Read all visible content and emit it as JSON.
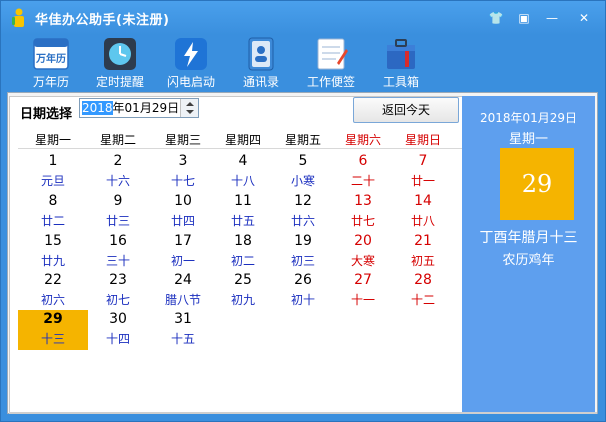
{
  "window": {
    "title": "华佳办公助手(未注册)",
    "controls": {
      "skin": "👕",
      "restore": "▣",
      "minimize": "—",
      "close": "✕"
    }
  },
  "toolbar": {
    "items": [
      {
        "label": "万年历",
        "icon": "calendar-icon",
        "icon_text": "万年历"
      },
      {
        "label": "定时提醒",
        "icon": "clock-icon"
      },
      {
        "label": "闪电启动",
        "icon": "lightning-icon"
      },
      {
        "label": "通讯录",
        "icon": "contacts-icon"
      },
      {
        "label": "工作便签",
        "icon": "notepad-icon"
      },
      {
        "label": "工具箱",
        "icon": "toolbox-icon"
      }
    ]
  },
  "calendar": {
    "date_label": "日期选择",
    "date_value_year": "2018",
    "date_value_rest": "年01月29日",
    "today_button": "返回今天",
    "weekdays": [
      "星期一",
      "星期二",
      "星期三",
      "星期四",
      "星期五",
      "星期六",
      "星期日"
    ],
    "days": [
      {
        "n": "1",
        "l": "元旦"
      },
      {
        "n": "2",
        "l": "十六"
      },
      {
        "n": "3",
        "l": "十七"
      },
      {
        "n": "4",
        "l": "十八"
      },
      {
        "n": "5",
        "l": "小寒"
      },
      {
        "n": "6",
        "l": "二十"
      },
      {
        "n": "7",
        "l": "廿一"
      },
      {
        "n": "8",
        "l": "廿二"
      },
      {
        "n": "9",
        "l": "廿三"
      },
      {
        "n": "10",
        "l": "廿四"
      },
      {
        "n": "11",
        "l": "廿五"
      },
      {
        "n": "12",
        "l": "廿六"
      },
      {
        "n": "13",
        "l": "廿七"
      },
      {
        "n": "14",
        "l": "廿八"
      },
      {
        "n": "15",
        "l": "廿九"
      },
      {
        "n": "16",
        "l": "三十"
      },
      {
        "n": "17",
        "l": "初一"
      },
      {
        "n": "18",
        "l": "初二"
      },
      {
        "n": "19",
        "l": "初三"
      },
      {
        "n": "20",
        "l": "大寒"
      },
      {
        "n": "21",
        "l": "初五"
      },
      {
        "n": "22",
        "l": "初六"
      },
      {
        "n": "23",
        "l": "初七"
      },
      {
        "n": "24",
        "l": "腊八节"
      },
      {
        "n": "25",
        "l": "初九"
      },
      {
        "n": "26",
        "l": "初十"
      },
      {
        "n": "27",
        "l": "十一"
      },
      {
        "n": "28",
        "l": "十二"
      },
      {
        "n": "29",
        "l": "十三"
      },
      {
        "n": "30",
        "l": "十四"
      },
      {
        "n": "31",
        "l": "十五"
      }
    ],
    "selected_day": "29"
  },
  "side_panel": {
    "date": "2018年01月29日",
    "weekday": "星期一",
    "day": "29",
    "lunar_line1": "丁酉年腊月十三",
    "lunar_line2": "农历鸡年"
  },
  "colors": {
    "accent": "#3a8fde",
    "weekend": "#d50000",
    "lunar_text": "#1b2fbf",
    "selected": "#f5b400",
    "side_panel": "#5e9fee"
  }
}
